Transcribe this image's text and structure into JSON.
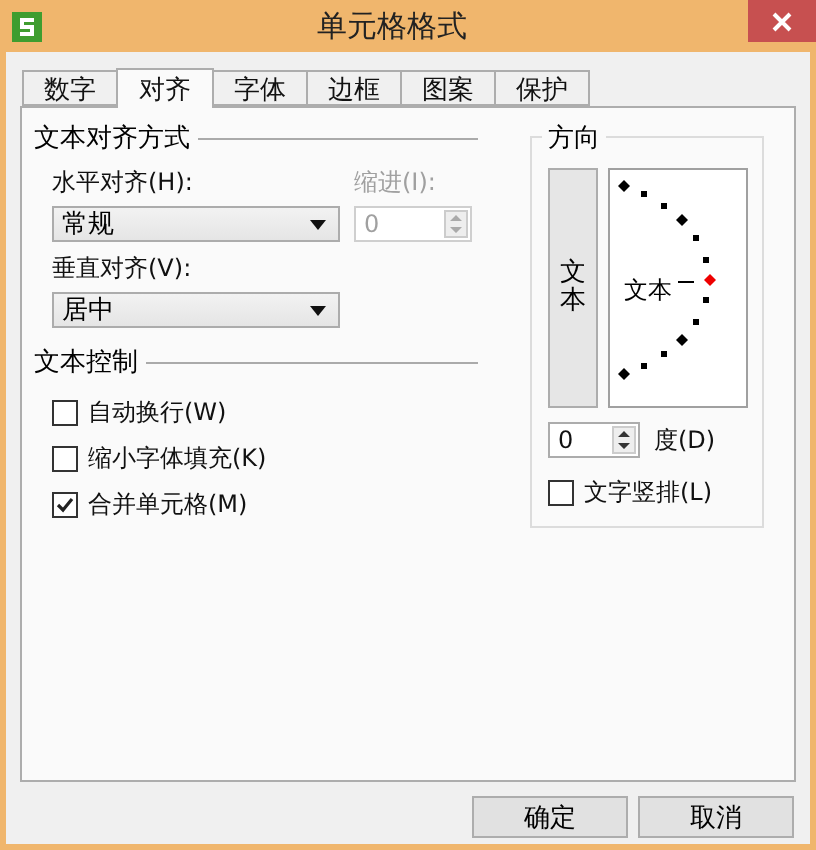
{
  "window": {
    "title": "单元格格式"
  },
  "tabs": [
    {
      "label": "数字",
      "selected": false
    },
    {
      "label": "对齐",
      "selected": true
    },
    {
      "label": "字体",
      "selected": false
    },
    {
      "label": "边框",
      "selected": false
    },
    {
      "label": "图案",
      "selected": false
    },
    {
      "label": "保护",
      "selected": false
    }
  ],
  "text_alignment": {
    "title": "文本对齐方式",
    "horizontal": {
      "label": "水平对齐(H):",
      "value": "常规"
    },
    "indent": {
      "label": "缩进(I):",
      "value": "0",
      "disabled": true
    },
    "vertical": {
      "label": "垂直对齐(V):",
      "value": "居中"
    }
  },
  "text_control": {
    "title": "文本控制",
    "options": [
      {
        "label": "自动换行(W)",
        "checked": false
      },
      {
        "label": "缩小字体填充(K)",
        "checked": false
      },
      {
        "label": "合并单元格(M)",
        "checked": true
      }
    ]
  },
  "orientation": {
    "title": "方向",
    "vertical_text": "文本",
    "dial_text": "文本",
    "degrees": {
      "value": "0",
      "unit": "度(D)"
    },
    "stacked_option": {
      "label": "文字竖排(L)",
      "checked": false
    }
  },
  "buttons": [
    "确定",
    "取消"
  ]
}
